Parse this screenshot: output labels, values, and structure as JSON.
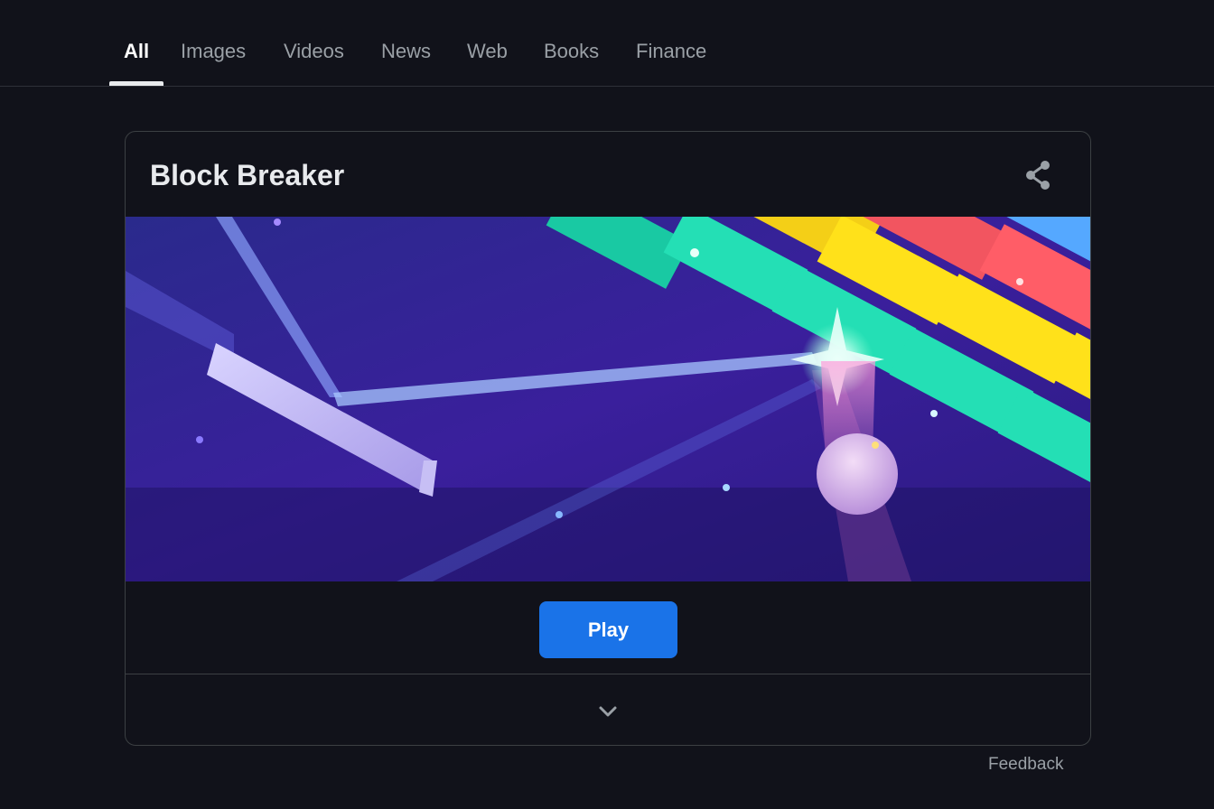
{
  "tabs": [
    {
      "label": "All",
      "active": true
    },
    {
      "label": "Images",
      "active": false
    },
    {
      "label": "Videos",
      "active": false
    },
    {
      "label": "News",
      "active": false
    },
    {
      "label": "Web",
      "active": false
    },
    {
      "label": "Books",
      "active": false
    },
    {
      "label": "Finance",
      "active": false
    }
  ],
  "card": {
    "title": "Block Breaker",
    "share_icon": "share-icon",
    "banner_image": "block-breaker-game-art",
    "play_label": "Play",
    "expand_icon": "chevron-down-icon"
  },
  "footer": {
    "feedback_label": "Feedback"
  },
  "colors": {
    "background": "#11121a",
    "accent": "#1a73e8",
    "text_primary": "#e8eaed",
    "text_secondary": "#9aa0a6",
    "border": "#3c4043"
  }
}
